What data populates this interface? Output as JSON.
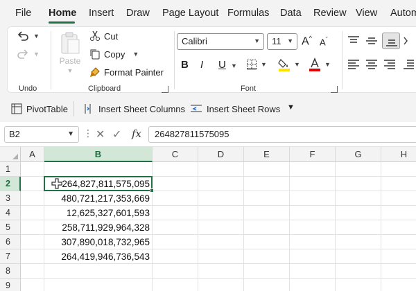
{
  "menu": {
    "tabs": [
      "File",
      "Home",
      "Insert",
      "Draw",
      "Page Layout",
      "Formulas",
      "Data",
      "Review",
      "View",
      "Autom"
    ],
    "active": "Home"
  },
  "ribbon": {
    "undo_group_label": "Undo",
    "clipboard": {
      "paste_label": "Paste",
      "cut_label": "Cut",
      "copy_label": "Copy",
      "format_painter_label": "Format Painter",
      "group_label": "Clipboard"
    },
    "font": {
      "font_name": "Calibri",
      "font_size": "11",
      "bold": "B",
      "italic": "I",
      "underline": "U",
      "group_label": "Font"
    }
  },
  "quick_access": {
    "pivot_table": "PivotTable",
    "insert_columns": "Insert Sheet Columns",
    "insert_rows": "Insert Sheet Rows"
  },
  "formula_bar": {
    "name_box": "B2",
    "fx": "fx",
    "value": "264827811575095"
  },
  "sheet": {
    "columns": [
      "A",
      "B",
      "C",
      "D",
      "E",
      "F",
      "G",
      "H"
    ],
    "selected_column": "B",
    "rows": [
      "1",
      "2",
      "3",
      "4",
      "5",
      "6",
      "7",
      "8",
      "9"
    ],
    "selected_row": "2",
    "column_b_values": [
      "",
      "264,827,811,575,095",
      "480,721,217,353,669",
      "12,625,327,601,593",
      "258,711,929,964,328",
      "307,890,018,732,965",
      "264,419,946,736,543",
      "",
      ""
    ]
  },
  "colors": {
    "accent": "#217346",
    "selected_header_bg": "#d3e7d9",
    "font_color_red": "#e00000",
    "highlight_yellow": "#ffe100"
  }
}
